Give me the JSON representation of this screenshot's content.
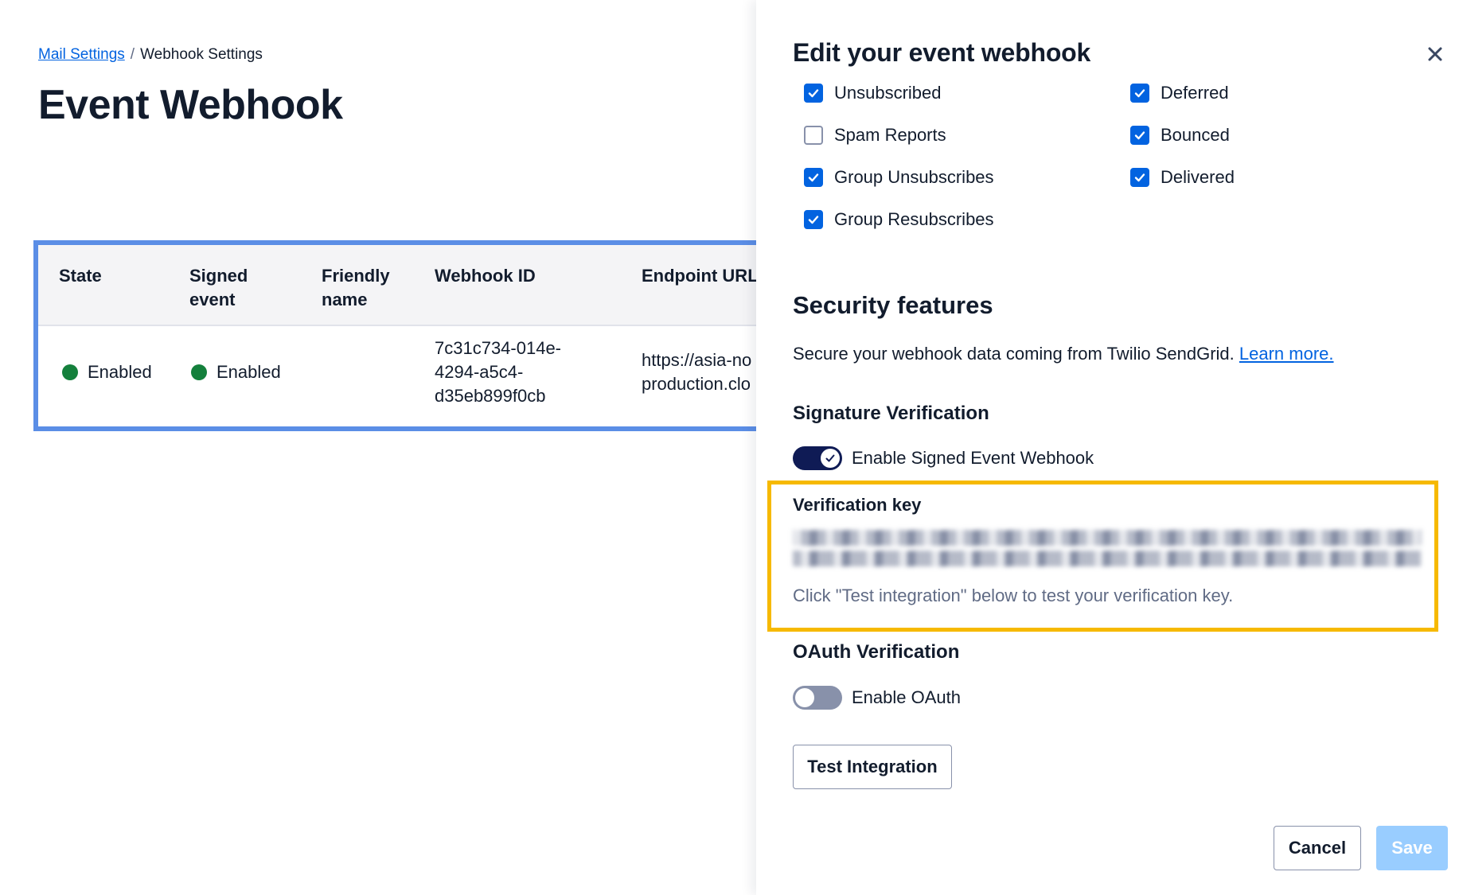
{
  "breadcrumb": {
    "parent": "Mail Settings",
    "separator": "/",
    "current": "Webhook Settings"
  },
  "page": {
    "title": "Event Webhook"
  },
  "table": {
    "headers": {
      "state": "State",
      "signed_line1": "Signed",
      "signed_line2": "event",
      "friendly_line1": "Friendly",
      "friendly_line2": "name",
      "webhook_id": "Webhook ID",
      "endpoint_url": "Endpoint URL"
    },
    "rows": [
      {
        "state": "Enabled",
        "signed_event": "Enabled",
        "friendly_name": "",
        "webhook_id_lines": [
          "7c31c734-014e-",
          "4294-a5c4-",
          "d35eb899f0cb"
        ],
        "endpoint_lines": [
          "https://asia-no",
          "production.clo"
        ]
      }
    ],
    "status_color": "#14803c"
  },
  "drawer": {
    "title": "Edit your event webhook",
    "close_icon": "close-icon",
    "events": {
      "left": [
        {
          "label": "Unsubscribed",
          "checked": true
        },
        {
          "label": "Spam Reports",
          "checked": false
        },
        {
          "label": "Group Unsubscribes",
          "checked": true
        },
        {
          "label": "Group Resubscribes",
          "checked": true
        }
      ],
      "right": [
        {
          "label": "Deferred",
          "checked": true
        },
        {
          "label": "Bounced",
          "checked": true
        },
        {
          "label": "Delivered",
          "checked": true
        }
      ]
    },
    "security": {
      "title": "Security features",
      "description": "Secure your webhook data coming from Twilio SendGrid.",
      "learn_more": "Learn more."
    },
    "signature": {
      "title": "Signature Verification",
      "toggle_label": "Enable Signed Event Webhook",
      "toggle_on": true,
      "key_label": "Verification key",
      "key_hint": "Click \"Test integration\" below to test your verification key."
    },
    "oauth": {
      "title": "OAuth Verification",
      "toggle_label": "Enable OAuth",
      "toggle_on": false
    },
    "buttons": {
      "test": "Test Integration",
      "cancel": "Cancel",
      "save": "Save"
    }
  },
  "colors": {
    "link": "#0263e0",
    "checkbox": "#0263e0",
    "toggle_on": "#0f1b55",
    "highlight": "#f6b900",
    "table_outline": "#5b8ee6",
    "save_disabled": "#99cdff"
  }
}
